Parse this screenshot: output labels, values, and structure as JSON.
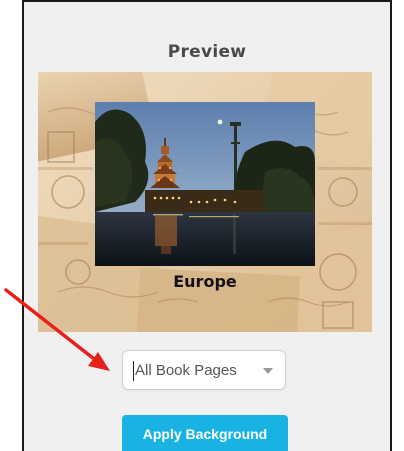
{
  "preview": {
    "title": "Preview",
    "caption": "Europe"
  },
  "scope_select": {
    "selected": "All Book Pages"
  },
  "actions": {
    "apply_label": "Apply Background"
  },
  "colors": {
    "panel_bg": "#f0f0f0",
    "button_bg": "#19b3e3",
    "annotation_arrow": "#e8201a"
  },
  "icons": {
    "select_caret": "chevron-down-icon"
  }
}
